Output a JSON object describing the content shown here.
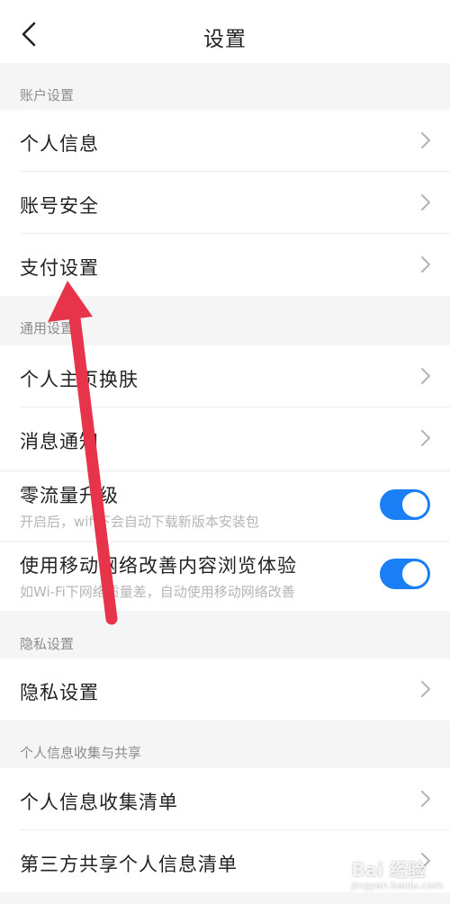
{
  "header": {
    "title": "设置",
    "back_icon": "chevron-left-icon"
  },
  "sections": {
    "account": {
      "header": "账户设置",
      "items": [
        "个人信息",
        "账号安全",
        "支付设置"
      ]
    },
    "general": {
      "header": "通用设置",
      "items": [
        "个人主页换肤",
        "消息通知"
      ],
      "toggles": [
        {
          "label": "零流量升级",
          "subtitle": "开启后，wifi下会自动下载新版本安装包",
          "enabled": true
        },
        {
          "label": "使用移动网络改善内容浏览体验",
          "subtitle": "如Wi-Fi下网络质量差，自动使用移动网络改善",
          "enabled": true
        }
      ]
    },
    "privacy": {
      "header": "隐私设置",
      "items": [
        "隐私设置"
      ]
    },
    "info_sharing": {
      "header": "个人信息收集与共享",
      "items": [
        "个人信息收集清单",
        "第三方共享个人信息清单"
      ]
    }
  },
  "colors": {
    "toggle_on": "#1a7ff5",
    "annotation_arrow": "#e8344a",
    "section_text": "#8c8c8c"
  },
  "watermark": {
    "text": "Bai 经验",
    "sub": "jingyan.baidu.com"
  }
}
